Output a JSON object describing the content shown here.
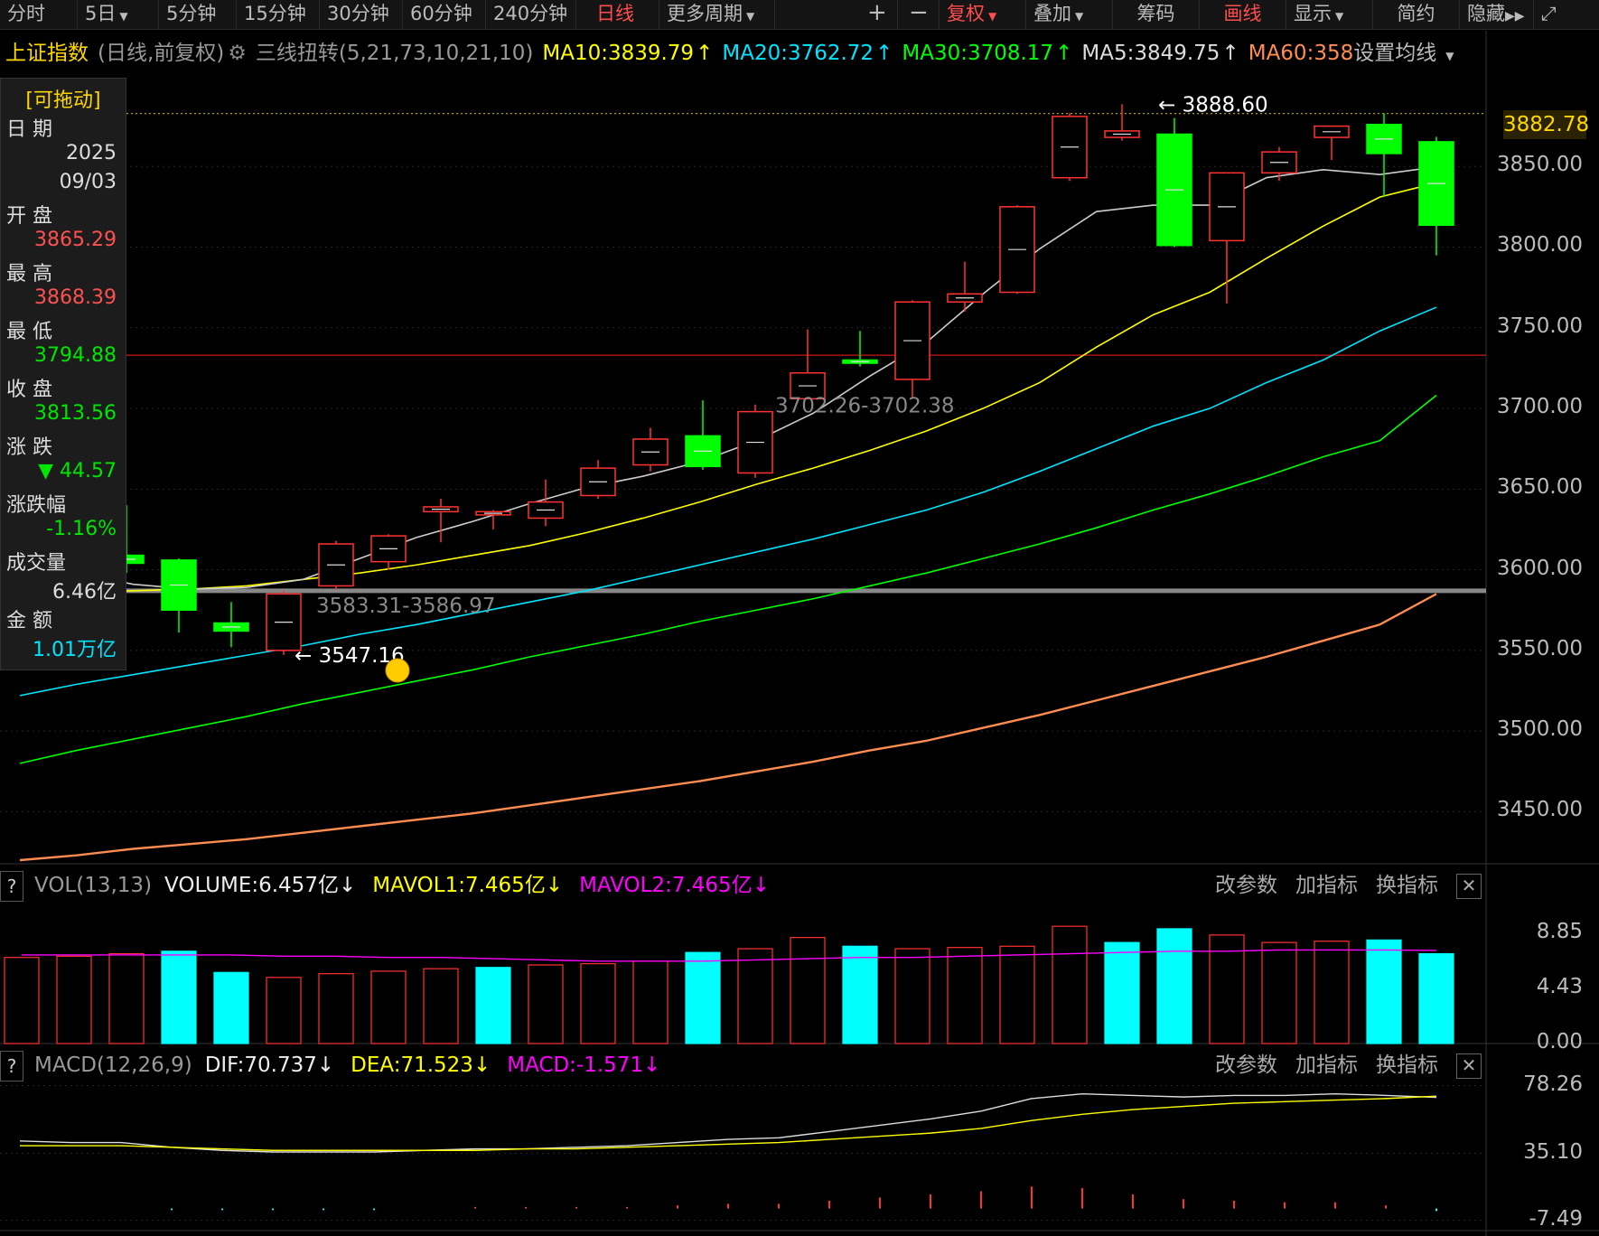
{
  "toolbar": {
    "items": [
      "分时",
      "5日",
      "5分钟",
      "15分钟",
      "30分钟",
      "60分钟",
      "240分钟",
      "日线",
      "更多周期",
      "+",
      "−",
      "复权",
      "叠加",
      "筹码",
      "画线",
      "显示",
      "简约",
      "隐藏"
    ],
    "active": [
      "日线",
      "复权",
      "画线"
    ],
    "dropdowns": [
      "5日",
      "更多周期",
      "复权",
      "叠加",
      "显示"
    ]
  },
  "info": {
    "name": "上证指数",
    "mode": "(日线,前复权)",
    "indicator": "三线扭转(5,21,73,10,21,10)",
    "ma10": "MA10:3839.79",
    "ma20": "MA20:3762.72",
    "ma30": "MA30:3708.17",
    "ma5": "MA5:3849.75",
    "ma60": "MA60:358",
    "settings": "设置均线"
  },
  "panel": {
    "title": "[可拖动]",
    "date_label": "日 期",
    "year": "2025",
    "date": "09/03",
    "open_label": "开 盘",
    "open": "3865.29",
    "high_label": "最 高",
    "high": "3868.39",
    "low_label": "最 低",
    "low": "3794.88",
    "close_label": "收 盘",
    "close": "3813.56",
    "change_label": "涨 跌",
    "change": "▼ 44.57",
    "pct_label": "涨跌幅",
    "pct": "-1.16%",
    "vol_label": "成交量",
    "vol": "6.46亿",
    "amt_label": "金 额",
    "amt": "1.01万亿"
  },
  "annotations": {
    "high_mark": "3888.60",
    "low_mark": "3547.16",
    "range1": "3702.26-3702.38",
    "range2": "3583.31-3586.97",
    "current_price": "3882.78"
  },
  "vol_header": {
    "q": "?",
    "name": "VOL(13,13)",
    "volume": "VOLUME:6.457亿",
    "mavol1": "MAVOL1:7.465亿",
    "mavol2": "MAVOL2:7.465亿",
    "btn1": "改参数",
    "btn2": "加指标",
    "btn3": "换指标",
    "close": "✕"
  },
  "macd_header": {
    "q": "?",
    "name": "MACD(12,26,9)",
    "dif": "DIF:70.737",
    "dea": "DEA:71.523",
    "macd": "MACD:-1.571",
    "btn1": "改参数",
    "btn2": "加指标",
    "btn3": "换指标",
    "close": "✕"
  },
  "colors": {
    "up": "#ff3232",
    "down": "#00ff00",
    "ma5": "#cccccc",
    "ma10": "#ffff00",
    "ma20": "#00e5ff",
    "ma30": "#00ff00",
    "ma60": "#ff8c50",
    "vol_up_fill": "#000000",
    "vol_down_fill": "#00ffff",
    "mavol2": "#ff00ff"
  },
  "chart_data": [
    {
      "type": "candlestick",
      "title": "上证指数",
      "ylim": [
        3420,
        3905
      ],
      "yticks": [
        3450,
        3500,
        3550,
        3600,
        3650,
        3700,
        3750,
        3800,
        3850
      ],
      "ytick_labels": [
        "3450.00",
        "3500.00",
        "3550.00",
        "3600.00",
        "3650.00",
        "3700.00",
        "3750.00",
        "3800.00",
        "3850.00"
      ],
      "candles": [
        {
          "o": 3609,
          "h": 3640,
          "l": 3598,
          "c": 3604
        },
        {
          "o": 3606,
          "h": 3607,
          "l": 3561,
          "c": 3575
        },
        {
          "o": 3567,
          "h": 3580,
          "l": 3552,
          "c": 3562
        },
        {
          "o": 3550,
          "h": 3587,
          "l": 3547.16,
          "c": 3585
        },
        {
          "o": 3590,
          "h": 3618,
          "l": 3588,
          "c": 3616
        },
        {
          "o": 3605,
          "h": 3622,
          "l": 3600,
          "c": 3621
        },
        {
          "o": 3636,
          "h": 3644,
          "l": 3617,
          "c": 3639
        },
        {
          "o": 3634,
          "h": 3637,
          "l": 3625,
          "c": 3636
        },
        {
          "o": 3632,
          "h": 3656,
          "l": 3627,
          "c": 3642
        },
        {
          "o": 3646,
          "h": 3668,
          "l": 3644,
          "c": 3663
        },
        {
          "o": 3665,
          "h": 3688,
          "l": 3661,
          "c": 3681
        },
        {
          "o": 3683,
          "h": 3705,
          "l": 3662,
          "c": 3664
        },
        {
          "o": 3660,
          "h": 3702.38,
          "l": 3657,
          "c": 3698
        },
        {
          "o": 3706,
          "h": 3749,
          "l": 3706,
          "c": 3722
        },
        {
          "o": 3730,
          "h": 3748,
          "l": 3726,
          "c": 3728
        },
        {
          "o": 3718,
          "h": 3767,
          "l": 3706,
          "c": 3766
        },
        {
          "o": 3766,
          "h": 3791,
          "l": 3760,
          "c": 3771
        },
        {
          "o": 3772,
          "h": 3826,
          "l": 3771,
          "c": 3825
        },
        {
          "o": 3843,
          "h": 3883,
          "l": 3841,
          "c": 3881
        },
        {
          "o": 3868,
          "h": 3888.6,
          "l": 3866,
          "c": 3872
        },
        {
          "o": 3870,
          "h": 3880,
          "l": 3800,
          "c": 3801
        },
        {
          "o": 3804,
          "h": 3846,
          "l": 3765,
          "c": 3846
        },
        {
          "o": 3846,
          "h": 3862,
          "l": 3841,
          "c": 3859
        },
        {
          "o": 3868,
          "h": 3875,
          "l": 3854,
          "c": 3875
        },
        {
          "o": 3876,
          "h": 3883,
          "l": 3831,
          "c": 3858
        },
        {
          "o": 3865.29,
          "h": 3868.39,
          "l": 3794.88,
          "c": 3813.56
        }
      ],
      "ma": {
        "MA5": [
          3606,
          3598,
          3591,
          3588,
          3589,
          3594,
          3607,
          3620,
          3630,
          3641,
          3651,
          3658,
          3667,
          3680,
          3697,
          3720,
          3741,
          3771,
          3799,
          3822,
          3826,
          3826,
          3843,
          3848,
          3845,
          3849.75
        ],
        "MA10": [
          3584,
          3586,
          3587,
          3588,
          3590,
          3594,
          3598,
          3603,
          3609,
          3615,
          3623,
          3632,
          3642,
          3653,
          3663,
          3674,
          3686,
          3700,
          3716,
          3738,
          3758,
          3772,
          3793,
          3813,
          3831,
          3839.79
        ],
        "MA20": [
          3522,
          3529,
          3535,
          3541,
          3547,
          3553,
          3560,
          3566,
          3573,
          3580,
          3587,
          3595,
          3603,
          3611,
          3619,
          3628,
          3637,
          3648,
          3661,
          3675,
          3689,
          3700,
          3716,
          3730,
          3748,
          3762.72
        ],
        "MA30": [
          3480,
          3488,
          3495,
          3502,
          3509,
          3517,
          3524,
          3531,
          3538,
          3546,
          3553,
          3560,
          3568,
          3575,
          3582,
          3590,
          3598,
          3607,
          3616,
          3626,
          3637,
          3647,
          3658,
          3670,
          3680,
          3708.17
        ],
        "MA60": [
          3420,
          3423,
          3427,
          3430,
          3433,
          3437,
          3441,
          3445,
          3449,
          3454,
          3459,
          3464,
          3469,
          3475,
          3481,
          3488,
          3494,
          3502,
          3510,
          3519,
          3528,
          3537,
          3546,
          3556,
          3566,
          3585
        ]
      },
      "hlines": [
        {
          "y": 3882.78,
          "style": "dotted",
          "color": "#c8b400"
        },
        {
          "y": 3733,
          "style": "solid",
          "color": "#cc1818"
        },
        {
          "y": 3586.97,
          "style": "solid",
          "color": "#888888"
        }
      ],
      "ma60_end_start_index": 4
    },
    {
      "type": "bar",
      "title": "VOL(13,13)",
      "ylim": [
        0,
        10.5
      ],
      "yticks": [
        0,
        4.43,
        8.85
      ],
      "ytick_labels": [
        "0.00",
        "4.43",
        "8.85"
      ],
      "values": [
        6.9,
        7.0,
        7.2,
        7.4,
        5.7,
        5.3,
        5.6,
        5.8,
        6.0,
        6.1,
        6.3,
        6.4,
        6.6,
        7.3,
        7.6,
        8.5,
        7.8,
        7.6,
        7.7,
        7.8,
        9.4,
        8.1,
        9.2,
        8.7,
        8.1,
        8.2,
        8.3,
        7.2
      ],
      "up": [
        true,
        true,
        true,
        false,
        false,
        true,
        true,
        true,
        true,
        false,
        true,
        true,
        true,
        false,
        true,
        true,
        false,
        true,
        true,
        true,
        true,
        false,
        false,
        true,
        true,
        true,
        false,
        false
      ],
      "mavol1": [
        7.1,
        7.1,
        7.1,
        7.1,
        7.1,
        7.0,
        7.0,
        6.9,
        6.9,
        6.8,
        6.7,
        6.6,
        6.6,
        6.6,
        6.7,
        6.8,
        6.9,
        6.9,
        7.0,
        7.1,
        7.2,
        7.3,
        7.4,
        7.4,
        7.5,
        7.5,
        7.5,
        7.465
      ]
    },
    {
      "type": "line",
      "title": "MACD(12,26,9)",
      "ylim": [
        -10,
        82
      ],
      "yticks": [
        -7.49,
        35.1,
        78.26
      ],
      "ytick_labels": [
        "-7.49",
        "35.10",
        "78.26"
      ],
      "dif": [
        43,
        42,
        42,
        39,
        37,
        36,
        36,
        36,
        37,
        38,
        38,
        39,
        40,
        42,
        44,
        45,
        49,
        53,
        57,
        62,
        70,
        73,
        72,
        71,
        72,
        72,
        73,
        72,
        70.737
      ],
      "dea": [
        40,
        40,
        40,
        39,
        38,
        37,
        37,
        37,
        37,
        37,
        38,
        38,
        39,
        40,
        41,
        42,
        44,
        46,
        48,
        51,
        56,
        60,
        63,
        65,
        67,
        68,
        69,
        70,
        71.523
      ],
      "macd": [
        0,
        0,
        0,
        -1,
        -1,
        -1,
        -1,
        -1,
        0,
        1,
        1,
        1,
        1,
        2,
        3,
        3,
        5,
        7,
        9,
        11,
        14,
        13,
        9,
        6,
        5,
        4,
        4,
        2,
        -1.571
      ]
    }
  ]
}
